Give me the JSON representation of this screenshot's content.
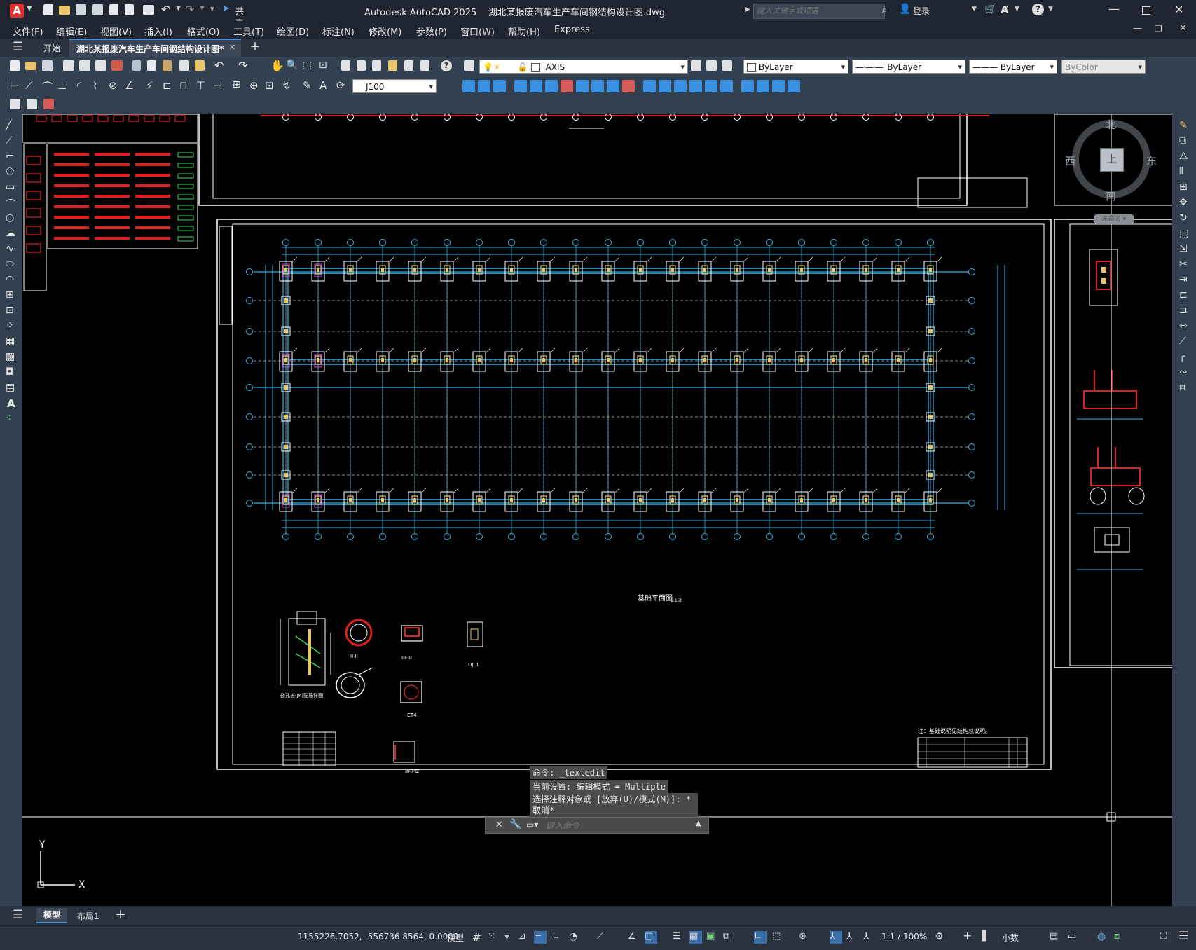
{
  "app": {
    "title": "Autodesk AutoCAD 2025",
    "filename": "湖北某报废汽车生产车间钢结构设计图.dwg",
    "search_placeholder": "键入关键字或短语",
    "share_label": "共享",
    "login_label": "登录",
    "accent": "#e0312f"
  },
  "menus": [
    "文件(F)",
    "编辑(E)",
    "视图(V)",
    "插入(I)",
    "格式(O)",
    "工具(T)",
    "绘图(D)",
    "标注(N)",
    "修改(M)",
    "参数(P)",
    "窗口(W)",
    "帮助(H)",
    "Express"
  ],
  "tabs": {
    "start_label": "开始",
    "doc_label": "湖北某报废汽车生产车间钢结构设计图*"
  },
  "toolbar": {
    "layer": "AXIS",
    "color": "ByLayer",
    "linetype": "ByLayer",
    "lineweight": "ByLayer",
    "plotstyle": "ByColor",
    "dimstyle": "J100"
  },
  "viewcube": {
    "north": "北",
    "south": "南",
    "east": "东",
    "west": "西",
    "face": "上",
    "wcs": "未命名"
  },
  "drawing": {
    "plan_title": "基础平面图",
    "plan_scale": "1:150",
    "note": "注：基础说明见结构总说明。",
    "detail_labels": [
      "II-II",
      "III-III",
      "DJL1",
      "CT4",
      "嵌孔桩(JK)配筋详图",
      "砖护壁"
    ]
  },
  "ucs": {
    "x_label": "X",
    "y_label": "Y"
  },
  "command": {
    "history": [
      "命令: _textedit",
      "当前设置: 编辑模式 = Multiple",
      "选择注释对象或 [放弃(U)/模式(M)]: *取消*"
    ],
    "placeholder": "键入命令"
  },
  "layout_tabs": [
    "模型",
    "布局1"
  ],
  "status": {
    "coords": "1155226.7052, -556736.8564, 0.0000",
    "space": "模型",
    "scale": "1:1 / 100%",
    "units": "小数"
  }
}
